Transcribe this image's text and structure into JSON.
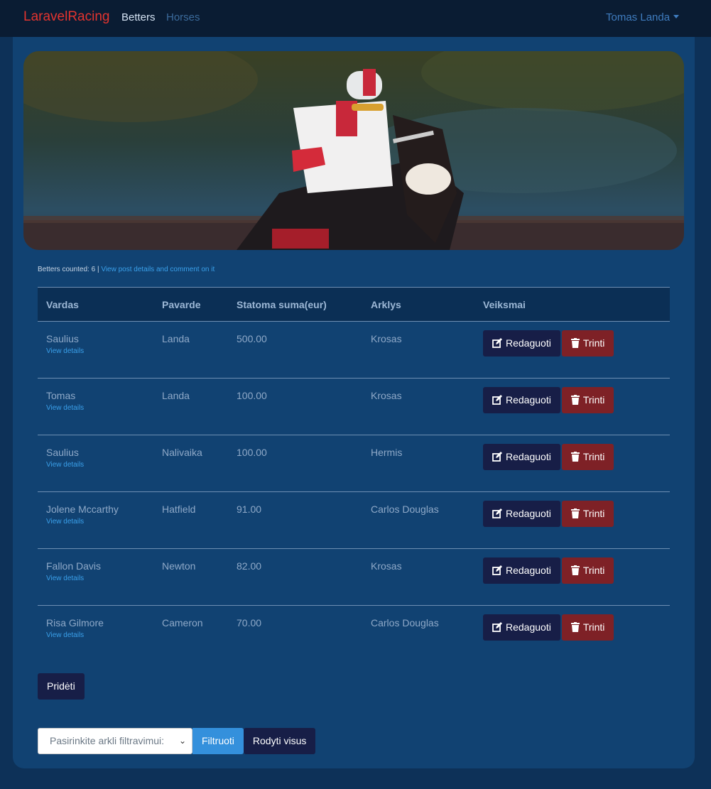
{
  "nav": {
    "brand": "LaravelRacing",
    "links": [
      "Betters",
      "Horses"
    ],
    "user": "Tomas Landa"
  },
  "counter": {
    "text": "Betters counted: 6 | ",
    "link": "View post details and comment on it"
  },
  "table": {
    "headers": [
      "Vardas",
      "Pavarde",
      "Statoma suma(eur)",
      "Arklys",
      "Veiksmai"
    ],
    "rows": [
      {
        "name": "Saulius",
        "surname": "Landa",
        "amount": "500.00",
        "horse": "Krosas"
      },
      {
        "name": "Tomas",
        "surname": "Landa",
        "amount": "100.00",
        "horse": "Krosas"
      },
      {
        "name": "Saulius",
        "surname": "Nalivaika",
        "amount": "100.00",
        "horse": "Hermis"
      },
      {
        "name": "Jolene Mccarthy",
        "surname": "Hatfield",
        "amount": "91.00",
        "horse": "Carlos Douglas"
      },
      {
        "name": "Fallon Davis",
        "surname": "Newton",
        "amount": "82.00",
        "horse": "Krosas"
      },
      {
        "name": "Risa Gilmore",
        "surname": "Cameron",
        "amount": "70.00",
        "horse": "Carlos Douglas"
      }
    ],
    "details_label": "View details",
    "edit_label": "Redaguoti",
    "delete_label": "Trinti"
  },
  "add_label": "Pridėti",
  "filter": {
    "placeholder": "Pasirinkite arkli filtravimui:",
    "filter_label": "Filtruoti",
    "show_all_label": "Rodyti visus"
  }
}
